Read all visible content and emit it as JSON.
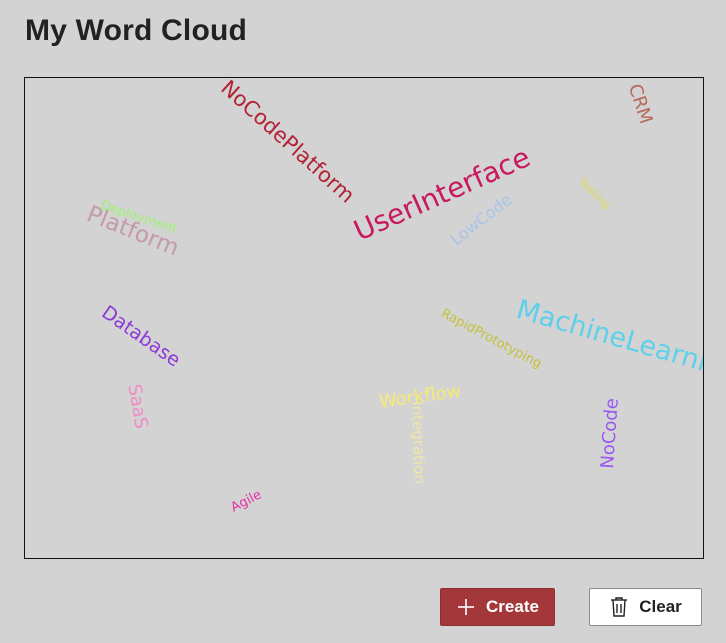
{
  "page": {
    "title": "My Word Cloud"
  },
  "cloud": {
    "words": [
      {
        "text": "NoCodePlatform",
        "color": "#b22234"
      },
      {
        "text": "CRM",
        "color": "#b56a5a"
      },
      {
        "text": "UserInterface",
        "color": "#c8195e"
      },
      {
        "text": "Testing",
        "color": "#e0d75b"
      },
      {
        "text": "LowCode",
        "color": "#a9c3ea"
      },
      {
        "text": "Deployment",
        "color": "#9cf26f"
      },
      {
        "text": "Platform",
        "color": "#c49aab"
      },
      {
        "text": "Database",
        "color": "#8d3ad8"
      },
      {
        "text": "RapidPrototyping",
        "color": "#c4c13a"
      },
      {
        "text": "MachineLearning",
        "color": "#5ed0ea"
      },
      {
        "text": "SaaS",
        "color": "#f08bc4"
      },
      {
        "text": "Workflow",
        "color": "#f6ea72"
      },
      {
        "text": "Integration",
        "color": "#efe7a6"
      },
      {
        "text": "NoCode",
        "color": "#9a57f2"
      },
      {
        "text": "Agile",
        "color": "#e62fa9"
      }
    ]
  },
  "actions": {
    "create_label": "Create",
    "clear_label": "Clear"
  },
  "colors": {
    "background": "#d3d3d3",
    "create_button": "#a4373a",
    "clear_button": "#ffffff"
  },
  "icons": {
    "create": "plus-icon",
    "clear": "trash-icon"
  }
}
